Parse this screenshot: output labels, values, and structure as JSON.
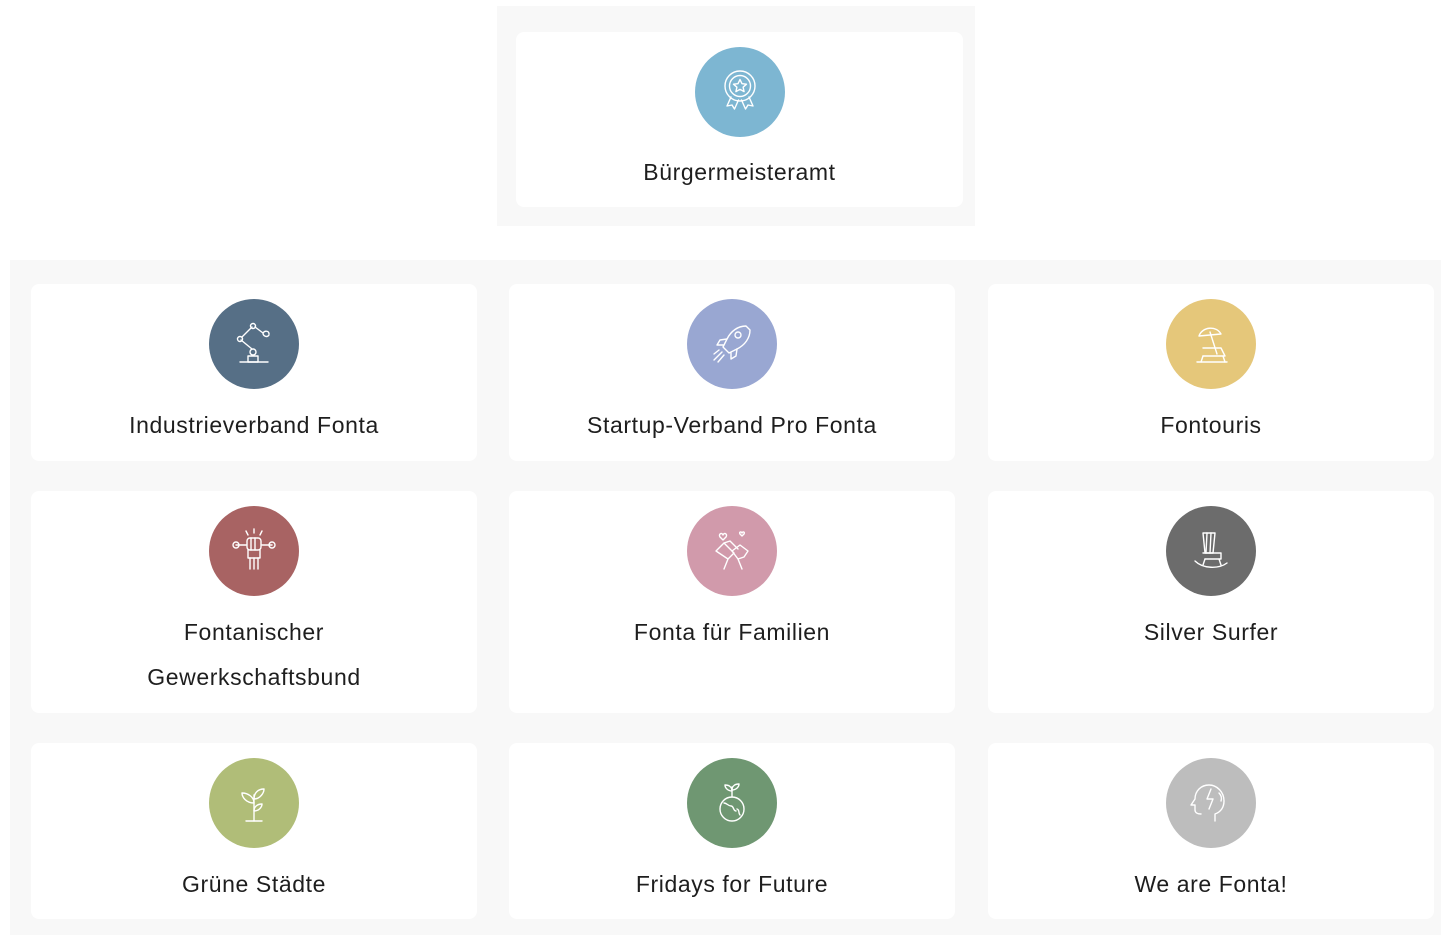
{
  "top": {
    "label": "Bürgermeisteramt",
    "icon": "award-badge-icon",
    "color": "#7db6d2"
  },
  "cards": [
    {
      "label": "Industrieverband Fonta",
      "icon": "robot-arm-icon",
      "color": "#566f86"
    },
    {
      "label": "Startup-Verband Pro Fonta",
      "icon": "rocket-icon",
      "color": "#99a7d2"
    },
    {
      "label": "Fontouris",
      "icon": "beach-chair-umbrella-icon",
      "color": "#e5c77a"
    },
    {
      "label": "Fontanischer Gewerkschaftsbund",
      "icon": "raised-fist-wrench-icon",
      "color": "#a86363"
    },
    {
      "label": "Fonta für Familien",
      "icon": "holding-hands-icon",
      "color": "#d19aab"
    },
    {
      "label": "Silver Surfer",
      "icon": "rocking-chair-icon",
      "color": "#6c6c6c"
    },
    {
      "label": "Grüne Städte",
      "icon": "sprout-icon",
      "color": "#b0bd78"
    },
    {
      "label": "Fridays for Future",
      "icon": "earth-sprout-icon",
      "color": "#6f9772"
    },
    {
      "label": "We are Fonta!",
      "icon": "head-idea-icon",
      "color": "#bdbdbd"
    }
  ]
}
